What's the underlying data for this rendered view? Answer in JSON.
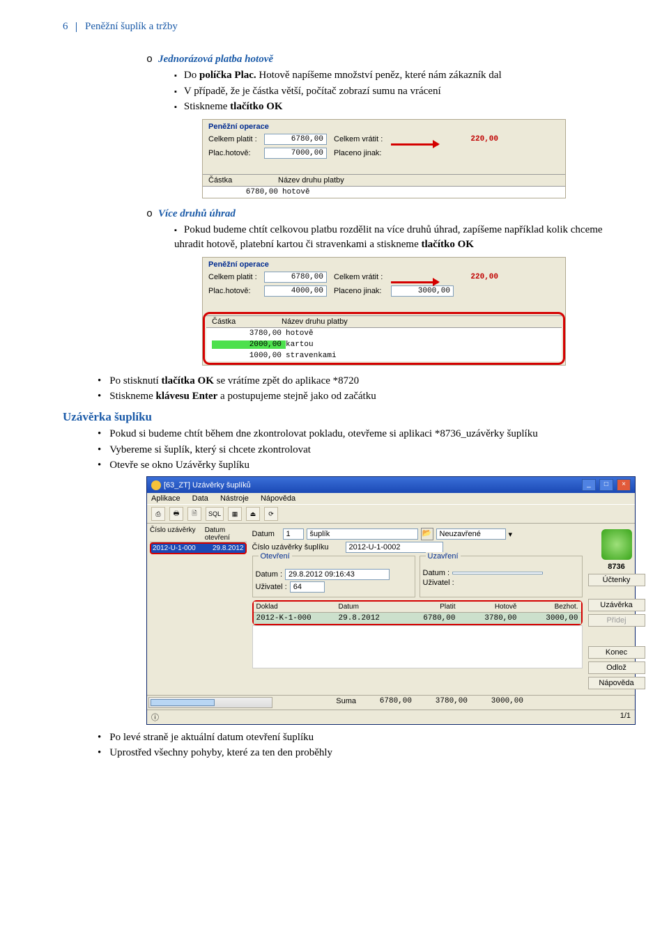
{
  "header": {
    "page": "6",
    "title": "Peněžní šuplík a tržby"
  },
  "section1": {
    "h": "Jednorázová platba hotově",
    "items": [
      "Do políčka Plac. Hotově napíšeme množství peněz, které nám zákazník dal",
      "V případě, že je částka větší, počítač zobrazí sumu na vrácení",
      "Stiskneme tlačítko OK"
    ]
  },
  "panel1": {
    "title": "Peněžní operace",
    "celkem_platit_lbl": "Celkem platit :",
    "celkem_platit": "6780,00",
    "celkem_vratit_lbl": "Celkem vrátit :",
    "celkem_vratit": "220,00",
    "plac_hotove_lbl": "Plac.hotově:",
    "plac_hotove": "7000,00",
    "placeno_jinak_lbl": "Placeno jinak:",
    "col_castka": "Částka",
    "col_nazev": "Název druhu platby",
    "rows": [
      {
        "amt": "6780,00",
        "name": "hotově"
      }
    ]
  },
  "section2": {
    "h": "Více druhů úhrad",
    "items": [
      "Pokud budeme chtít celkovou platbu rozdělit na více druhů úhrad, zapíšeme například kolik chceme uhradit hotově, platební kartou či stravenkami a stiskneme tlačítko OK"
    ]
  },
  "panel2": {
    "title": "Peněžní operace",
    "celkem_platit_lbl": "Celkem platit :",
    "celkem_platit": "6780,00",
    "celkem_vratit_lbl": "Celkem vrátit :",
    "celkem_vratit": "220,00",
    "plac_hotove_lbl": "Plac.hotově:",
    "plac_hotove": "4000,00",
    "placeno_jinak_lbl": "Placeno jinak:",
    "placeno_jinak": "3000,00",
    "col_castka": "Částka",
    "col_nazev": "Název druhu platby",
    "rows": [
      {
        "amt": "3780,00",
        "name": "hotově",
        "sel": false
      },
      {
        "amt": "2000,00",
        "name": "kartou",
        "sel": true
      },
      {
        "amt": "1000,00",
        "name": "stravenkami",
        "sel": false
      }
    ]
  },
  "after_panels": [
    "Po stisknutí tlačítka OK se vrátíme zpět do aplikace *8720",
    "Stiskneme klávesu Enter  a postupujeme stejně jako od začátku"
  ],
  "section3": {
    "h": "Uzávěrka šuplíku",
    "items": [
      "Pokud si budeme chtít během dne zkontrolovat pokladu, otevřeme si aplikaci *8736_uzávěrky šuplíku",
      "Vybereme si šuplík, který si chcete zkontrolovat",
      "Otevře se okno Uzávěrky šuplíku"
    ]
  },
  "app": {
    "title": "[63_ZT] Uzávěrky šuplíků",
    "menu": [
      "Aplikace",
      "Data",
      "Nástroje",
      "Nápověda"
    ],
    "left_headers": [
      "Číslo uzávěrky",
      "Datum otevření"
    ],
    "left_row": [
      "2012-U-1-000",
      "29.8.2012"
    ],
    "top": {
      "datum_lbl": "Datum",
      "datum": "1",
      "suplik_lbl": "šuplík",
      "stav": "Neuzavřené",
      "cislo_lbl": "Číslo uzávěrky šuplíku",
      "cislo": "2012-U-1-0002"
    },
    "otevreni": {
      "title": "Otevření",
      "datum_lbl": "Datum :",
      "datum": "29.8.2012 09:16:43",
      "uzivatel_lbl": "Uživatel :",
      "uzivatel": "64"
    },
    "uzavreni": {
      "title": "Uzavření",
      "datum_lbl": "Datum :",
      "uzivatel_lbl": "Uživatel :"
    },
    "grid": {
      "headers": [
        "Doklad",
        "Datum",
        "Platit",
        "Hotově",
        "Bezhot."
      ],
      "row": [
        "2012-K-1-000",
        "29.8.2012",
        "6780,00",
        "3780,00",
        "3000,00"
      ]
    },
    "right": {
      "code": "8736",
      "btns": [
        "Účtenky",
        "Uzávěrka",
        "Přidej",
        "Konec",
        "Odlož",
        "Nápověda"
      ]
    },
    "sum": {
      "label": "Suma",
      "v1": "6780,00",
      "v2": "3780,00",
      "v3": "3000,00"
    },
    "status": "1/1"
  },
  "after_app": [
    "Po levé straně je aktuální datum otevření šuplíku",
    "Uprostřed všechny pohyby, které za ten den proběhly"
  ]
}
